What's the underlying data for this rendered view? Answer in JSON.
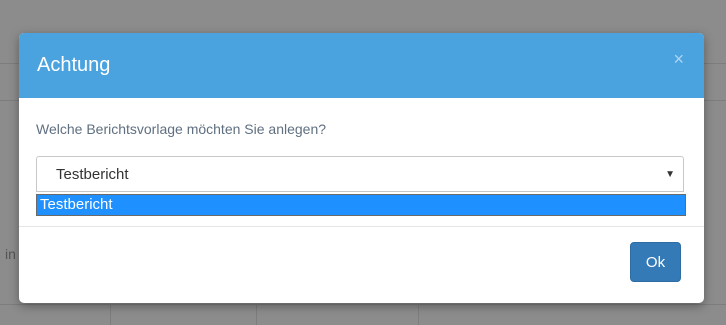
{
  "background": {
    "partial_text": "in"
  },
  "dialog": {
    "title": "Achtung",
    "close_label": "×",
    "prompt": "Welche Berichtsvorlage möchten Sie anlegen?",
    "select": {
      "selected_value": "Testbericht",
      "arrow": "▼",
      "options": [
        "Testbericht"
      ]
    },
    "ok_label": "Ok"
  },
  "colors": {
    "header": "#4aa3df",
    "ok_button": "#337ab7",
    "option_highlight": "#1e90ff"
  }
}
